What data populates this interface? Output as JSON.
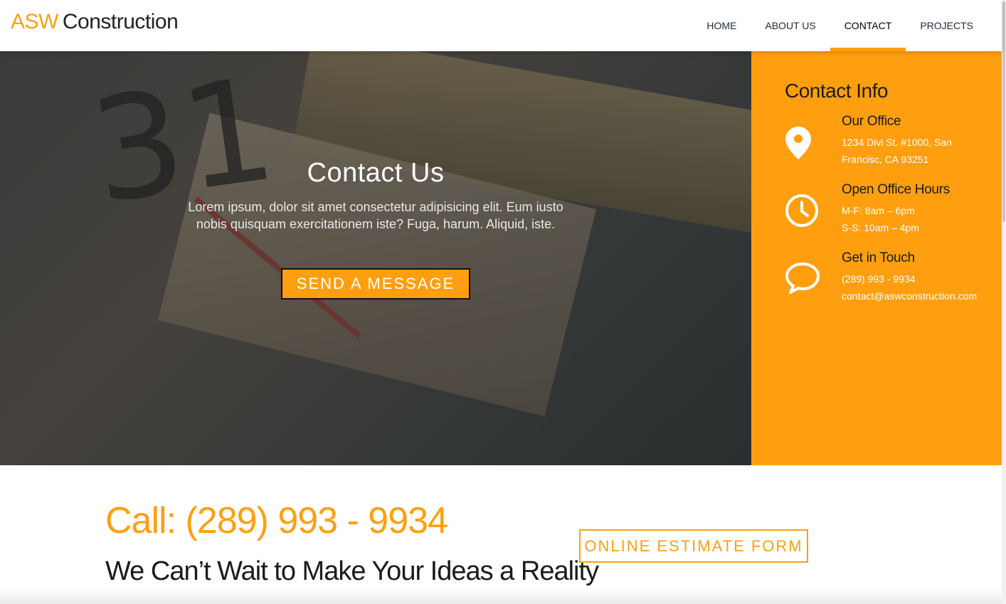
{
  "header": {
    "logo_brand": "ASW",
    "logo_rest": "Construction",
    "nav": [
      {
        "label": "HOME",
        "active": false
      },
      {
        "label": "ABOUT US",
        "active": false
      },
      {
        "label": "CONTACT",
        "active": true
      },
      {
        "label": "PROJECTS",
        "active": false
      }
    ]
  },
  "hero": {
    "title": "Contact Us",
    "text": "Lorem ipsum, dolor sit amet consectetur adipisicing elit. Eum iusto nobis quisquam exercitationem iste? Fuga, harum. Aliquid, iste.",
    "button_label": "SEND A MESSAGE"
  },
  "contact_info": {
    "title": "Contact Info",
    "office": {
      "icon": "map-pin-icon",
      "heading": "Our Office",
      "line1": "1234 Divi St. #1000, San",
      "line2": "Francisc, CA 93251"
    },
    "hours": {
      "icon": "clock-icon",
      "heading": "Open Office Hours",
      "line1": "M-F: 8am – 6pm",
      "line2": "S-S: 10am – 4pm"
    },
    "touch": {
      "icon": "chat-bubble-icon",
      "heading": "Get in Touch",
      "line1": "(289) 993 - 9934",
      "line2": "contact@aswconstruction.com"
    }
  },
  "lower": {
    "call": "Call: (289) 993 - 9934",
    "tagline": "We Can’t Wait to Make Your Ideas a Reality",
    "estimate_button": "ONLINE ESTIMATE FORM"
  },
  "colors": {
    "accent": "#ff9f0f",
    "dark": "#1b1b1b",
    "white": "#ffffff"
  }
}
